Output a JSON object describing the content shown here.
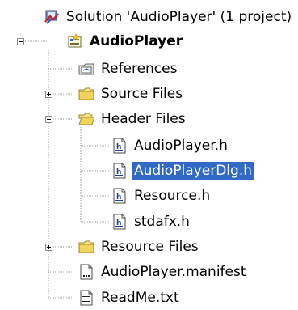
{
  "tree": {
    "solution_label": "Solution 'AudioPlayer' (1 project)",
    "project_label": "AudioPlayer",
    "items": [
      {
        "label": "References"
      },
      {
        "label": "Source Files"
      },
      {
        "label": "Header Files"
      },
      {
        "label": "AudioPlayer.h"
      },
      {
        "label": "AudioPlayerDlg.h"
      },
      {
        "label": "Resource.h"
      },
      {
        "label": "stdafx.h"
      },
      {
        "label": "Resource Files"
      },
      {
        "label": "AudioPlayer.manifest"
      },
      {
        "label": "ReadMe.txt"
      }
    ],
    "selected_item": "AudioPlayerDlg.h",
    "selection_color": "#316ac5"
  }
}
